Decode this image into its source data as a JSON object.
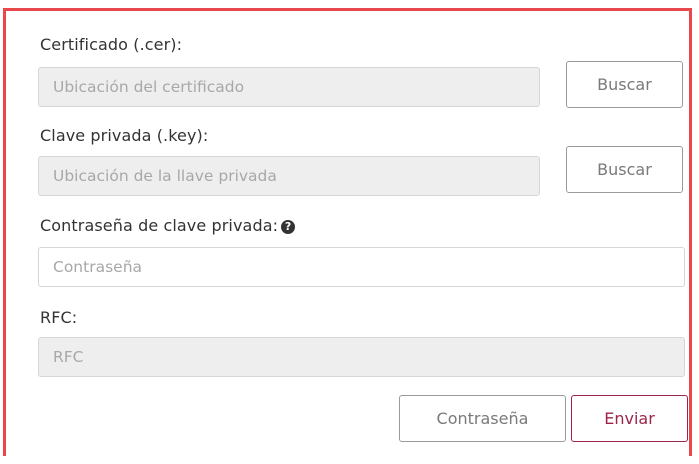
{
  "form": {
    "certificate": {
      "label": "Certificado (.cer):",
      "placeholder": "Ubicación del certificado",
      "button": "Buscar"
    },
    "private_key": {
      "label": "Clave privada (.key):",
      "placeholder": "Ubicación de la llave privada",
      "button": "Buscar"
    },
    "password": {
      "label": "Contraseña de clave privada:",
      "help_icon": "question-circle-icon",
      "help_glyph": "?",
      "placeholder": "Contraseña"
    },
    "rfc": {
      "label": "RFC:",
      "placeholder": "RFC"
    },
    "actions": {
      "secondary_label": "Contraseña",
      "primary_label": "Enviar"
    }
  },
  "colors": {
    "frame_border": "#e8474c",
    "primary": "#9d2449",
    "disabled_bg": "#eeeeee"
  }
}
